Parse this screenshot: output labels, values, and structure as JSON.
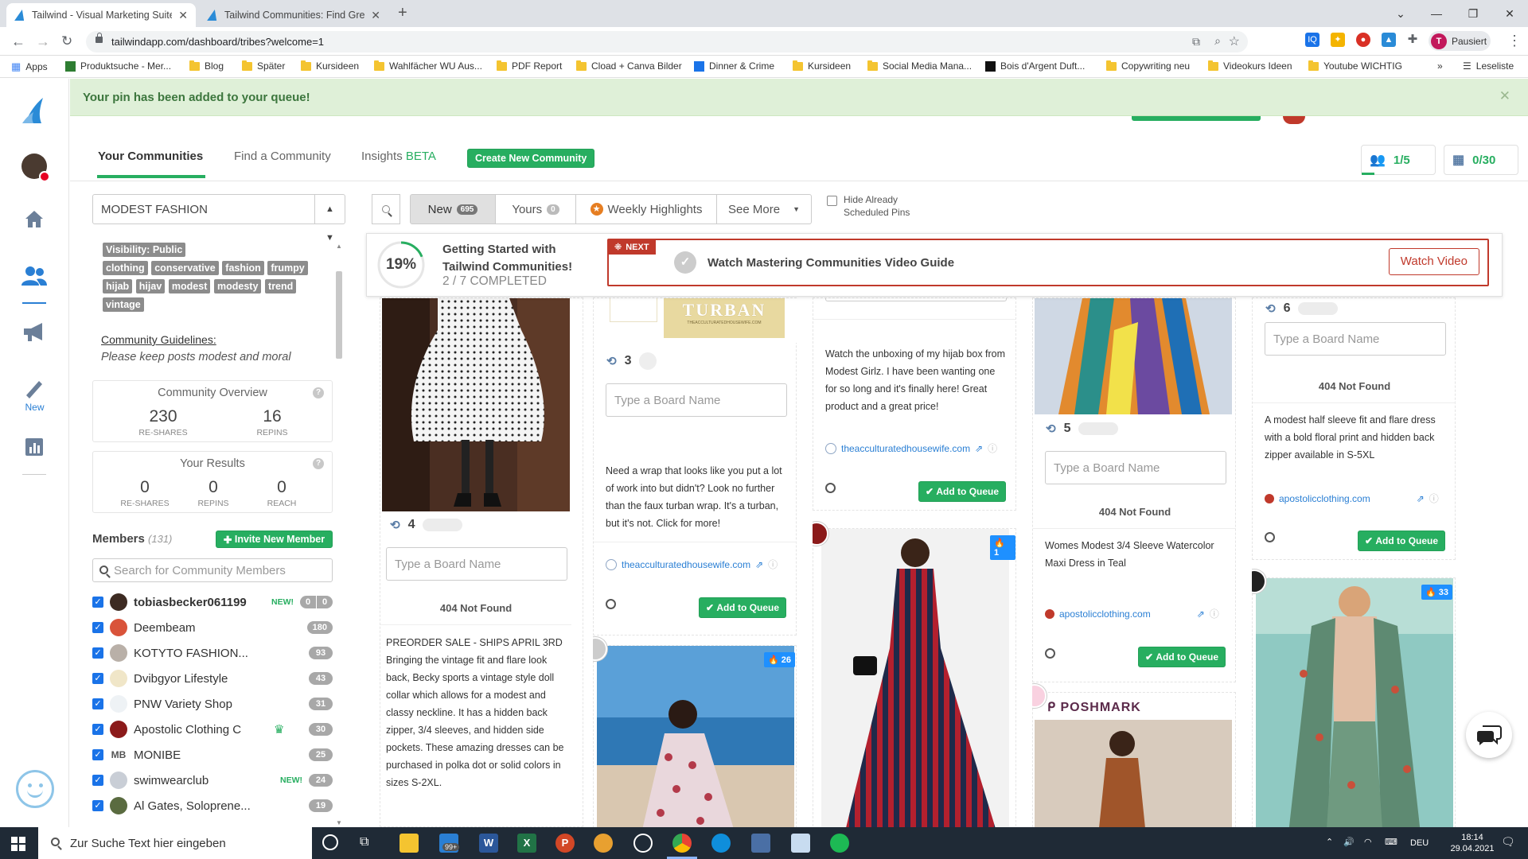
{
  "browser": {
    "tabs": [
      {
        "title": "Tailwind - Visual Marketing Suite",
        "active": true
      },
      {
        "title": "Tailwind Communities: Find Grea",
        "active": false
      }
    ],
    "url": "tailwindapp.com/dashboard/tribes?welcome=1",
    "profile_initial": "T",
    "profile_label": "Pausiert",
    "bookmarks": [
      "Apps",
      "Produktsuche - Mer...",
      "Blog",
      "Später",
      "Kursideen",
      "Wahlfächer WU Aus...",
      "PDF Report",
      "Cload + Canva Bilder",
      "Dinner & Crime",
      "Kursideen",
      "Social Media Mana...",
      "Bois d'Argent Duft...",
      "Copywriting neu",
      "Videokurs Ideen",
      "Youtube WICHTIG"
    ],
    "reading_list": "Leseliste"
  },
  "leftnav": {
    "new_label": "New"
  },
  "banner": {
    "text": "Your pin has been added to your queue!"
  },
  "topnav": {
    "tabs": [
      "Your Communities",
      "Find a Community"
    ],
    "insights": "Insights",
    "beta": "BETA",
    "create_btn": "Create New Community",
    "counter_members": "1/5",
    "counter_pins": "0/30"
  },
  "sidebar": {
    "community_select": "MODEST FASHION",
    "visibility": "Visibility: Public",
    "tags": [
      "clothing",
      "conservative",
      "fashion",
      "frumpy",
      "hijab",
      "hijav",
      "modest",
      "modesty",
      "trend",
      "vintage"
    ],
    "guidelines_label": "Community Guidelines:",
    "guidelines_text": "Please keep posts modest and moral",
    "overview": {
      "title": "Community Overview",
      "reshares": "230",
      "reshares_label": "RE-SHARES",
      "repins": "16",
      "repins_label": "REPINS"
    },
    "results": {
      "title": "Your Results",
      "reshares": "0",
      "reshares_label": "RE-SHARES",
      "repins": "0",
      "repins_label": "REPINS",
      "reach": "0",
      "reach_label": "REACH"
    },
    "members_title": "Members",
    "members_count": "(131)",
    "invite_btn": "Invite New Member",
    "search_placeholder": "Search for Community Members",
    "members": [
      {
        "name": "tobiasbecker061199",
        "new": "NEW!",
        "count": "0",
        "count2": "0",
        "bold": true
      },
      {
        "name": "Deembeam",
        "new": "",
        "count": "180"
      },
      {
        "name": "KOTYTO FASHION...",
        "new": "",
        "count": "93"
      },
      {
        "name": "Dvibgyor Lifestyle",
        "new": "",
        "count": "43"
      },
      {
        "name": "PNW Variety Shop",
        "new": "",
        "count": "31"
      },
      {
        "name": "Apostolic Clothing C",
        "new": "",
        "count": "30"
      },
      {
        "name": "MONIBE",
        "new": "",
        "count": "25"
      },
      {
        "name": "swimwearclub",
        "new": "NEW!",
        "count": "24"
      },
      {
        "name": "Al Gates, Soloprene...",
        "new": "",
        "count": "19"
      }
    ]
  },
  "filters": {
    "new_label": "New",
    "new_count": "695",
    "yours_label": "Yours",
    "yours_count": "0",
    "weekly": "Weekly Highlights",
    "see_more": "See More",
    "hide_label_1": "Hide Already",
    "hide_label_2": "Scheduled Pins"
  },
  "progress": {
    "percent": "19%",
    "percent_value": 19,
    "title_1": "Getting Started with",
    "title_2": "Tailwind Communities!",
    "completed": "2 / 7 COMPLETED",
    "next_tag": "NEXT",
    "next_title": "Watch Mastering Communities Video Guide",
    "watch_btn": "Watch Video"
  },
  "pins": {
    "c1": {
      "repins": "4",
      "board_placeholder": "Type a Board Name",
      "not_found": "404 Not Found",
      "desc_title": "PREORDER SALE - SHIPS APRIL 3RD",
      "desc": "Bringing the vintage fit and flare look back, Becky sports a vintage style doll collar which allows for a modest and classy neckline. It has a hidden back zipper, 3/4 sleeves, and hidden side pockets. These amazing dresses can be purchased in polka dot or solid colors in sizes S-2XL."
    },
    "c2": {
      "image_text": "TURBAN",
      "image_sub": "THEACCULTURATEDHOUSEWIFE.COM",
      "repins": "3",
      "board_placeholder": "Type a Board Name",
      "desc": "Need a wrap that looks like you put a lot of work into but didn't? Look no further than the faux turban wrap. It's a turban, but it's not. Click for more!",
      "link": "theacculturatedhousewife.com",
      "add_btn": "Add to Queue",
      "hot2": "26"
    },
    "c3": {
      "desc": "Watch the unboxing of my hijab box from Modest Girlz. I have been wanting one for so long and it's finally here! Great product and a great price!",
      "link": "theacculturatedhousewife.com",
      "add_btn": "Add to Queue",
      "hot2": "1"
    },
    "c4": {
      "repins": "5",
      "board_placeholder": "Type a Board Name",
      "not_found": "404 Not Found",
      "desc": "Womes Modest 3/4 Sleeve Watercolor Maxi Dress in Teal",
      "link": "apostolicclothing.com",
      "add_btn": "Add to Queue",
      "poshmark": "POSHMARK"
    },
    "c5": {
      "repins": "6",
      "board_placeholder": "Type a Board Name",
      "not_found": "404 Not Found",
      "desc": "A modest half sleeve fit and flare dress with a bold floral print and hidden back zipper available in S-5XL",
      "link": "apostolicclothing.com",
      "add_btn": "Add to Queue",
      "hot2": "33"
    }
  },
  "taskbar": {
    "search_placeholder": "Zur Suche Text hier eingeben",
    "lang": "DEU",
    "time": "18:14",
    "date": "29.04.2021",
    "mail_badge": "99+"
  },
  "colors": {
    "green": "#27ae60",
    "red": "#c0392b",
    "blue": "#2a7fd4"
  }
}
